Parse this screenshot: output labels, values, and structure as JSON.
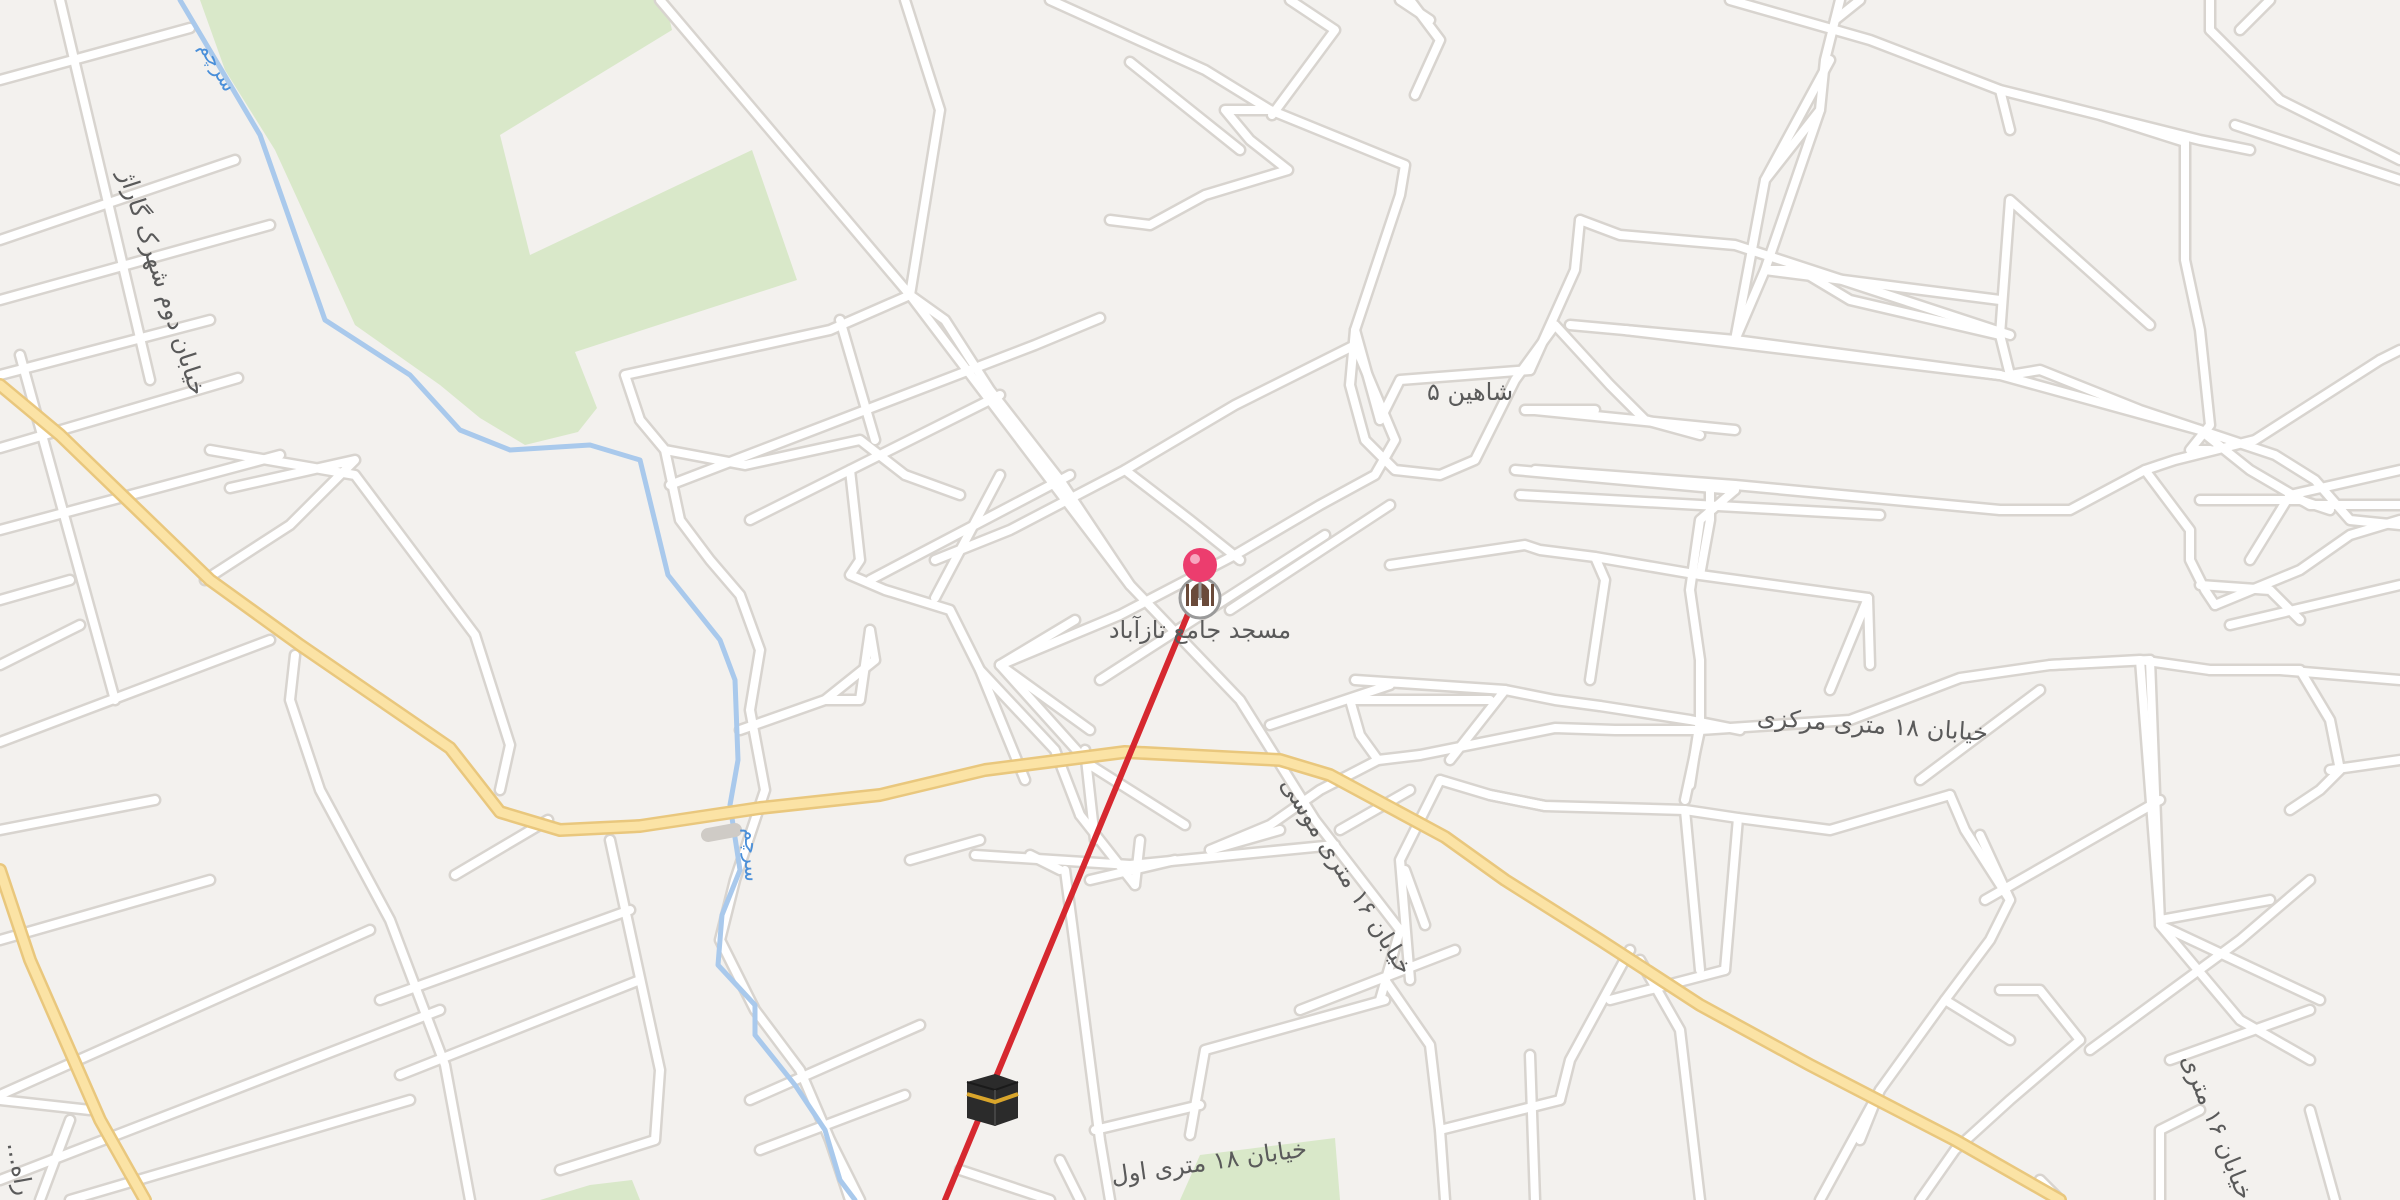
{
  "colors": {
    "background": "#f3f1ee",
    "park": "#d9e8c9",
    "street": "#ffffff",
    "street_casing": "#d8d4cf",
    "main_road": "#fbe3a5",
    "main_road_casing": "#e9c77d",
    "stream": "#a9c9ec",
    "qibla_line": "#d6282f",
    "pin": "#ec3d6e",
    "label": "#5a5a5a",
    "water_label": "#4a8fd9"
  },
  "map": {
    "qibla_line": "red line from the marked location toward the Kaaba icon",
    "location_pin": {
      "icon": "map-pin-icon"
    },
    "kaaba": {
      "icon": "kaaba-icon"
    },
    "mosque": {
      "icon": "mosque-icon",
      "label": "مسجد جامع تازآباد"
    },
    "street_labels": {
      "shahin5": "شاهین ۵",
      "central18": "خیابان ۱۸ متری مرکزی",
      "first18": "خیابان ۱۸ متری اول",
      "musa16": "خیابان ۱۶ متری موسی",
      "dowr_qadim": "خیابان دوم شهرک گاراژ",
      "right16": "خیابان ۱۶ متری",
      "edge_left": "...راه"
    },
    "water_labels": {
      "upper": "سرچم",
      "lower": "سرچم"
    }
  }
}
